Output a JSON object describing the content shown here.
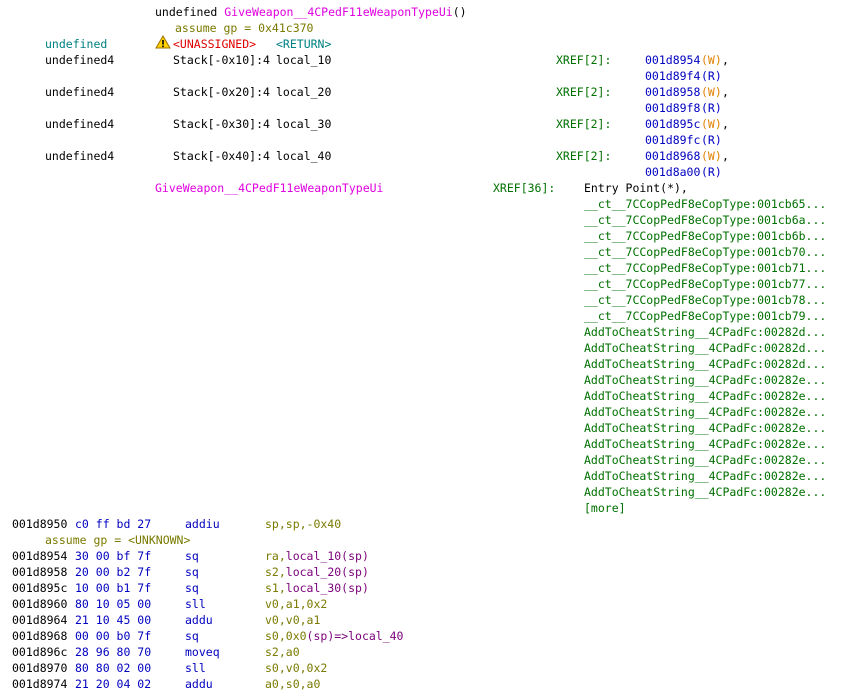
{
  "header": {
    "return_type": "undefined",
    "func_name": "GiveWeapon__4CPedF11eWeaponTypeUi",
    "parens": "()",
    "assume_gp": "assume gp = 0x41c370"
  },
  "return_row": {
    "type": "undefined",
    "storage": "<UNASSIGNED>",
    "name": "<RETURN>",
    "icon": "warning-triangle-icon"
  },
  "locals": [
    {
      "type": "undefined4",
      "storage": "Stack[-0x10]:4",
      "name": "local_10",
      "xref": "XREF[2]:",
      "ref1": "001d8954",
      "ref1_kind": "(W)",
      "ref1_sep": ",",
      "ref2": "001d89f4",
      "ref2_kind": "(R)"
    },
    {
      "type": "undefined4",
      "storage": "Stack[-0x20]:4",
      "name": "local_20",
      "xref": "XREF[2]:",
      "ref1": "001d8958",
      "ref1_kind": "(W)",
      "ref1_sep": ",",
      "ref2": "001d89f8",
      "ref2_kind": "(R)"
    },
    {
      "type": "undefined4",
      "storage": "Stack[-0x30]:4",
      "name": "local_30",
      "xref": "XREF[2]:",
      "ref1": "001d895c",
      "ref1_kind": "(W)",
      "ref1_sep": ",",
      "ref2": "001d89fc",
      "ref2_kind": "(R)"
    },
    {
      "type": "undefined4",
      "storage": "Stack[-0x40]:4",
      "name": "local_40",
      "xref": "XREF[2]:",
      "ref1": "001d8968",
      "ref1_kind": "(W)",
      "ref1_sep": ",",
      "ref2": "001d8a00",
      "ref2_kind": "(R)"
    }
  ],
  "label": {
    "name": "GiveWeapon__4CPedF11eWeaponTypeUi",
    "xref": "XREF[36]:",
    "refs": [
      "Entry Point(*),",
      "__ct__7CCopPedF8eCopType:001cb65...",
      "__ct__7CCopPedF8eCopType:001cb6a...",
      "__ct__7CCopPedF8eCopType:001cb6b...",
      "__ct__7CCopPedF8eCopType:001cb70...",
      "__ct__7CCopPedF8eCopType:001cb71...",
      "__ct__7CCopPedF8eCopType:001cb77...",
      "__ct__7CCopPedF8eCopType:001cb78...",
      "__ct__7CCopPedF8eCopType:001cb79...",
      "AddToCheatString__4CPadFc:00282d...",
      "AddToCheatString__4CPadFc:00282d...",
      "AddToCheatString__4CPadFc:00282d...",
      "AddToCheatString__4CPadFc:00282e...",
      "AddToCheatString__4CPadFc:00282e...",
      "AddToCheatString__4CPadFc:00282e...",
      "AddToCheatString__4CPadFc:00282e...",
      "AddToCheatString__4CPadFc:00282e...",
      "AddToCheatString__4CPadFc:00282e...",
      "AddToCheatString__4CPadFc:00282e...",
      "AddToCheatString__4CPadFc:00282e..."
    ],
    "more": "[more]"
  },
  "instructions": [
    {
      "addr": "001d8950",
      "bytes": "c0 ff bd 27",
      "mnem": "addiu",
      "ops": "sp,sp,-0x40"
    },
    {
      "addr": "001d8954",
      "bytes": "30 00 bf 7f",
      "mnem": "sq",
      "ops": "ra,local_10(sp)"
    },
    {
      "addr": "001d8958",
      "bytes": "20 00 b2 7f",
      "mnem": "sq",
      "ops": "s2,local_20(sp)"
    },
    {
      "addr": "001d895c",
      "bytes": "10 00 b1 7f",
      "mnem": "sq",
      "ops": "s1,local_30(sp)"
    },
    {
      "addr": "001d8960",
      "bytes": "80 10 05 00",
      "mnem": "sll",
      "ops": "v0,a1,0x2"
    },
    {
      "addr": "001d8964",
      "bytes": "21 10 45 00",
      "mnem": "addu",
      "ops": "v0,v0,a1"
    },
    {
      "addr": "001d8968",
      "bytes": "00 00 b0 7f",
      "mnem": "sq",
      "ops": "s0,0x0(sp)=>local_40"
    },
    {
      "addr": "001d896c",
      "bytes": "28 96 80 70",
      "mnem": "moveq",
      "ops": "s2,a0"
    },
    {
      "addr": "001d8970",
      "bytes": "80 80 02 00",
      "mnem": "sll",
      "ops": "s0,v0,0x2"
    },
    {
      "addr": "001d8974",
      "bytes": "21 20 04 02",
      "mnem": "addu",
      "ops": "a0,s0,a0"
    }
  ],
  "assume_unknown": "assume gp = <UNKNOWN>",
  "colors": {
    "function_name": "#e000e0",
    "assume": "#7a7a00",
    "return_type": "#008080",
    "unassigned": "#e00000",
    "address": "#0000c0",
    "xref": "#007000",
    "write": "#e08000",
    "mnemonic": "#000080",
    "operand": "#7a007a"
  }
}
